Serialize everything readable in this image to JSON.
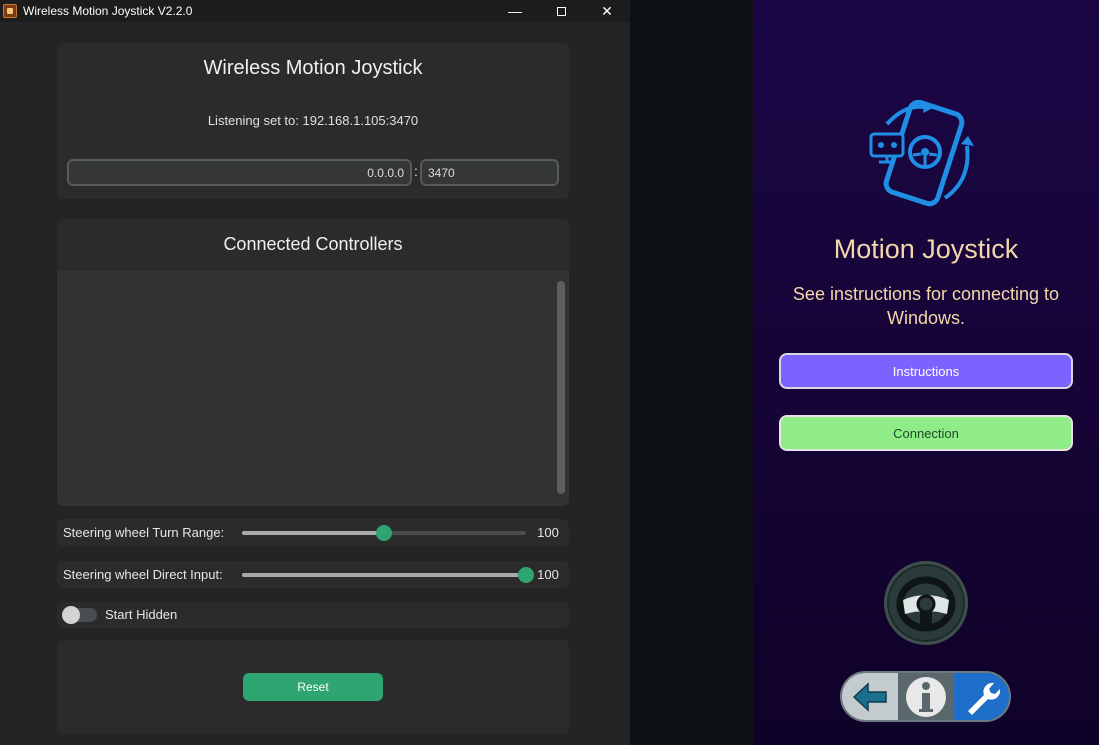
{
  "window": {
    "title": "Wireless Motion Joystick V2.2.0",
    "icon": "app-icon",
    "controls": {
      "minimize": "—",
      "close": "✕"
    }
  },
  "top_card": {
    "title": "Wireless Motion Joystick",
    "listening_text": "Listening set to: 192.168.1.105:3470",
    "ip_value": "0.0.0.0",
    "separator": ":",
    "port_value": "3470"
  },
  "controllers": {
    "title": "Connected Controllers",
    "items": []
  },
  "sliders": [
    {
      "label": "Steering wheel Turn Range:",
      "value": "100",
      "level": 0.5
    },
    {
      "label": "Steering wheel Direct Input:",
      "value": "100",
      "level": 1.0
    }
  ],
  "start_hidden": {
    "label": "Start Hidden",
    "on": false
  },
  "reset_label": "Reset",
  "phone_app": {
    "title": "Motion Joystick",
    "subtitle": "See instructions for connecting to Windows.",
    "instructions_label": "Instructions",
    "connection_label": "Connection",
    "icons": [
      "phone-controller-icon",
      "steering-wheel-icon",
      "back-arrow-icon",
      "info-icon",
      "wrench-icon"
    ]
  },
  "colors": {
    "accent_green": "#2fa572",
    "instructions_purple": "#7b63ff",
    "connection_green": "#8fec86",
    "phone_text": "#f2d7aa",
    "phone_bg": "#160437"
  }
}
